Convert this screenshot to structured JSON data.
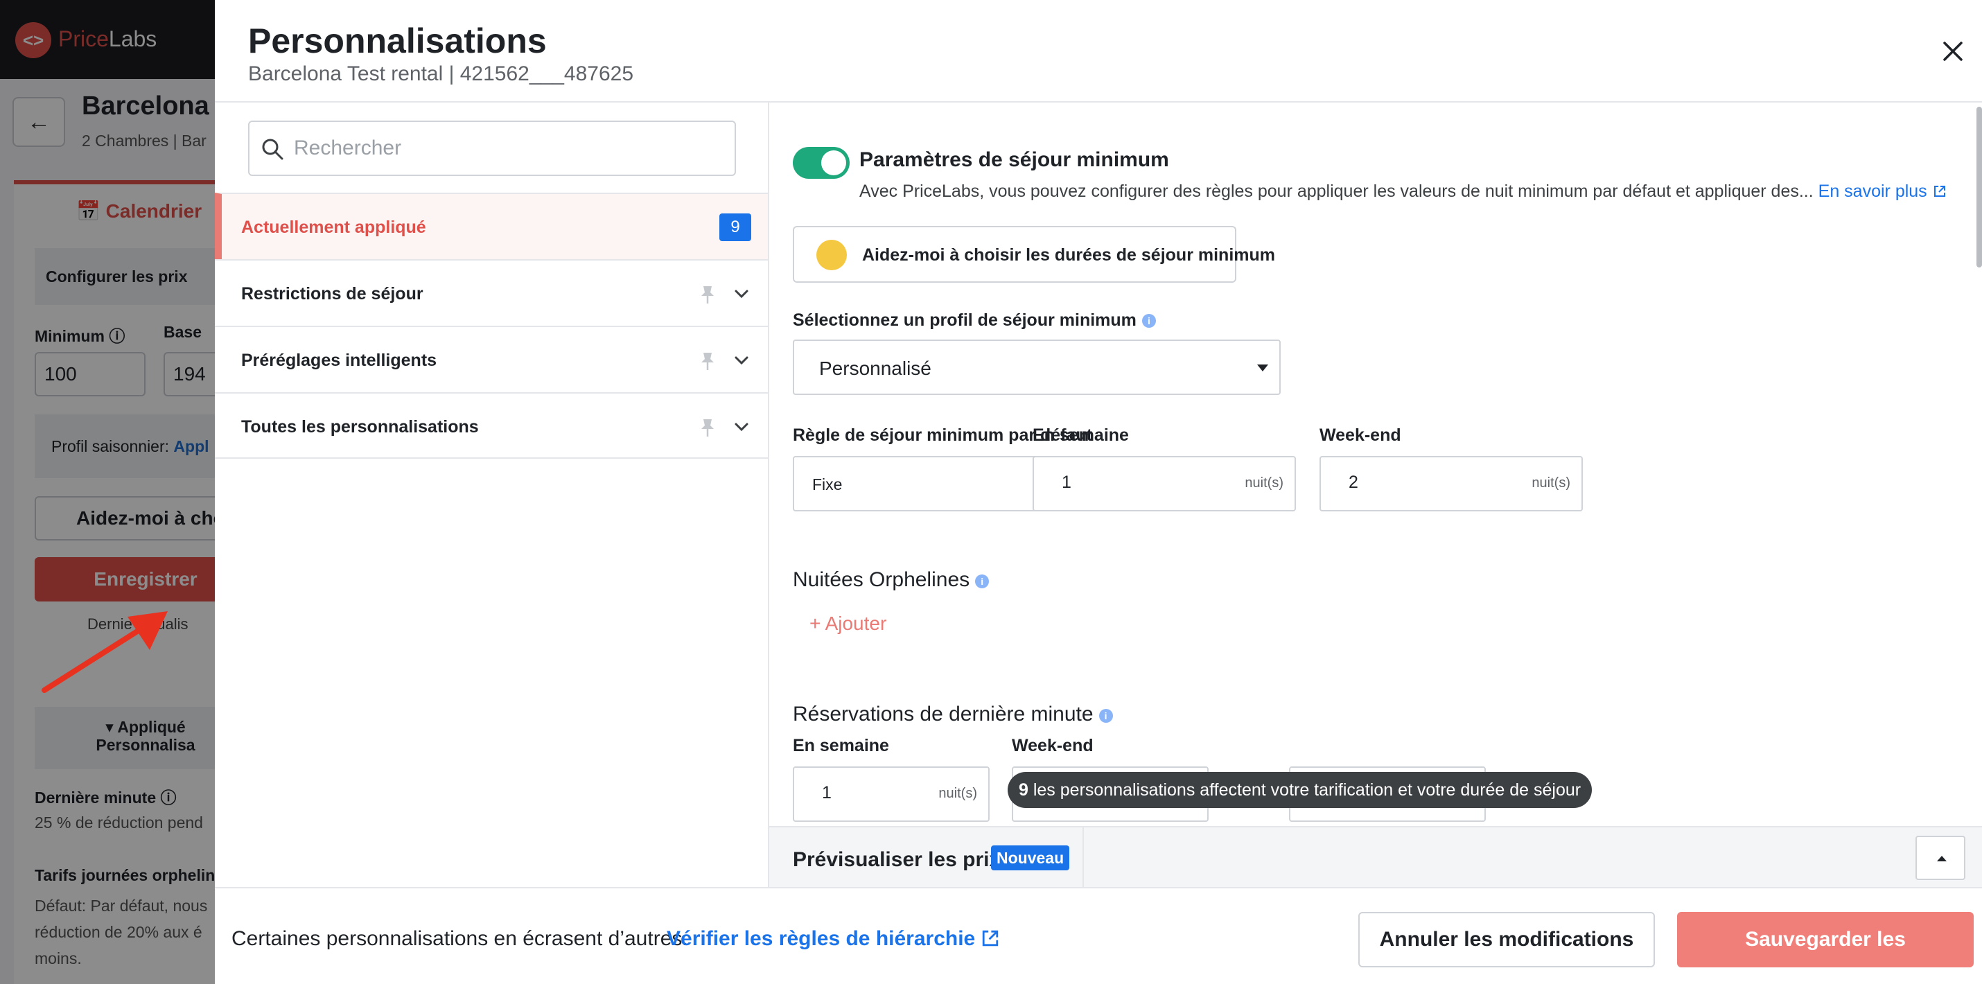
{
  "background": {
    "logo": {
      "part1": "Price",
      "part2": "Labs",
      "mark": "<>"
    },
    "listing_title": "Barcelona T",
    "listing_sub": "2 Chambres | Bar",
    "calendar_tab": "Calendrier",
    "configure_prices": "Configurer les prix",
    "min_label": "Minimum",
    "base_label": "Base",
    "min_value": "100",
    "base_value": "194",
    "season_label": "Profil saisonnier:",
    "season_value": "Appl",
    "help_label": "Aidez-moi à cho",
    "save_label": "Enregistrer",
    "updated_label": "Dernie actualis",
    "applied_label_1": "Appliqué",
    "applied_label_2": "Personnalisa",
    "last_minute_label": "Dernière minute",
    "last_minute_text": "25 % de réduction pend",
    "orphan_label": "Tarifs journées orphelin",
    "orphan_text": "Défaut: Par défaut, nous réduction de 20% aux é moins."
  },
  "drawer": {
    "title": "Personnalisations",
    "subtitle": "Barcelona Test rental | 421562___487625"
  },
  "search": {
    "placeholder": "Rechercher"
  },
  "nav": {
    "items": [
      {
        "label": "Actuellement appliqué",
        "badge": "9"
      },
      {
        "label": "Restrictions de séjour"
      },
      {
        "label": "Préréglages intelligents"
      },
      {
        "label": "Toutes les personnalisations"
      }
    ]
  },
  "min_stay": {
    "title": "Paramètres de séjour minimum",
    "description": "Avec PriceLabs, vous pouvez configurer des règles pour appliquer les valeurs de nuit minimum par défaut et appliquer des...",
    "learn_more": "En savoir plus",
    "help_button": "Aidez-moi à choisir les durées de séjour minimum",
    "profile_label": "Sélectionnez un profil de séjour minimum",
    "profile_value": "Personnalisé",
    "default_rule_label": "Règle de séjour minimum par défaut",
    "default_rule_value": "Fixe",
    "weekday_label": "En semaine",
    "weekday_value": "1",
    "weekend_label": "Week-end",
    "weekend_value": "2",
    "unit": "nuit(s)"
  },
  "orphan_nights": {
    "title": "Nuitées Orphelines",
    "add_label": "+ Ajouter"
  },
  "last_minute": {
    "title": "Réservations de dernière minute",
    "weekday_label": "En semaine",
    "weekday_value": "1",
    "weekend_label": "Week-end",
    "unit": "nuit(s)"
  },
  "tooltip": {
    "count": "9",
    "text": " les personnalisations affectent votre tarification et votre durée de séjour"
  },
  "preview": {
    "label": "Prévisualiser les prix",
    "badge": "Nouveau"
  },
  "footer": {
    "text": "Certaines personnalisations en écrasent d’autres.",
    "link": "Vérifier les règles de hiérarchie",
    "cancel": "Annuler les modifications",
    "save": "Sauvegarder les modifications"
  },
  "colors": {
    "brand_red": "#e0504a",
    "toggle_green": "#1ea97c",
    "link_blue": "#1a73e8",
    "save_button": "#f07f7a"
  }
}
